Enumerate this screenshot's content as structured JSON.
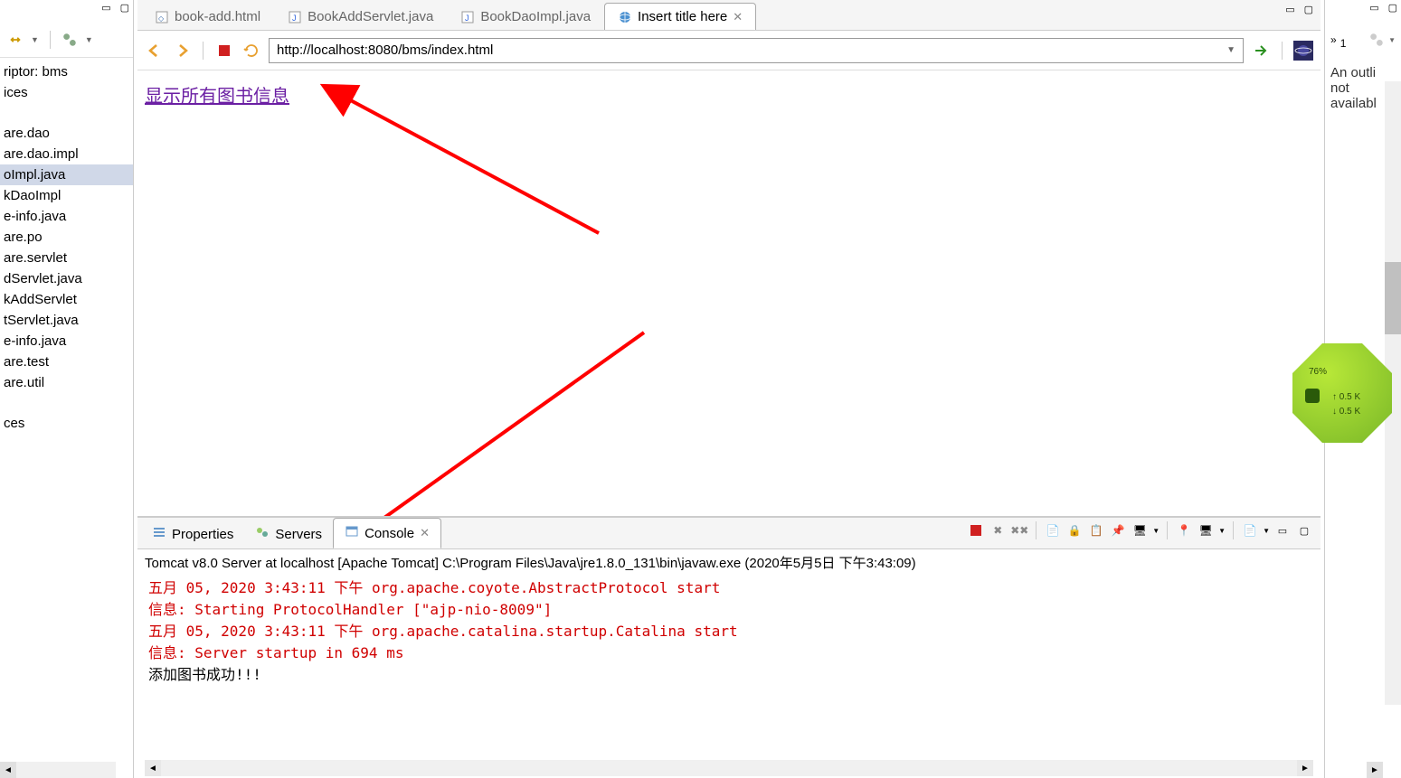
{
  "left_panel": {
    "items": [
      "riptor: bms",
      "ices",
      "",
      "are.dao",
      "are.dao.impl",
      "oImpl.java",
      "kDaoImpl",
      "e-info.java",
      "are.po",
      "are.servlet",
      "dServlet.java",
      "kAddServlet",
      "tServlet.java",
      "e-info.java",
      "are.test",
      "are.util",
      "",
      "ces"
    ],
    "selected_index": 5
  },
  "editor_tabs": [
    {
      "label": "book-add.html",
      "icon": "html",
      "active": false
    },
    {
      "label": "BookAddServlet.java",
      "icon": "java",
      "active": false
    },
    {
      "label": "BookDaoImpl.java",
      "icon": "java",
      "active": false
    },
    {
      "label": "Insert title here",
      "icon": "globe",
      "active": true
    }
  ],
  "browser": {
    "url": "http://localhost:8080/bms/index.html",
    "link_text": "显示所有图书信息"
  },
  "bottom_tabs": [
    {
      "label": "Properties",
      "icon": "properties",
      "active": false
    },
    {
      "label": "Servers",
      "icon": "servers",
      "active": false
    },
    {
      "label": "Console",
      "icon": "console",
      "active": true
    }
  ],
  "console": {
    "header": "Tomcat v8.0 Server at localhost [Apache Tomcat] C:\\Program Files\\Java\\jre1.8.0_131\\bin\\javaw.exe (2020年5月5日 下午3:43:09)",
    "lines": [
      {
        "text": "五月 05, 2020 3:43:11 下午 org.apache.coyote.AbstractProtocol start",
        "color": "red"
      },
      {
        "text": "信息: Starting ProtocolHandler [\"ajp-nio-8009\"]",
        "color": "red"
      },
      {
        "text": "五月 05, 2020 3:43:11 下午 org.apache.catalina.startup.Catalina start",
        "color": "red"
      },
      {
        "text": "信息: Server startup in 694 ms",
        "color": "red"
      },
      {
        "text": "添加图书成功!!!",
        "color": "black"
      }
    ]
  },
  "right_panel": {
    "tab_label": "1",
    "text_line1": "An outli",
    "text_line2": "not",
    "text_line3": "availabl"
  },
  "widget": {
    "percent": "76%",
    "up": "0.5 K",
    "down": "0.5 K"
  }
}
